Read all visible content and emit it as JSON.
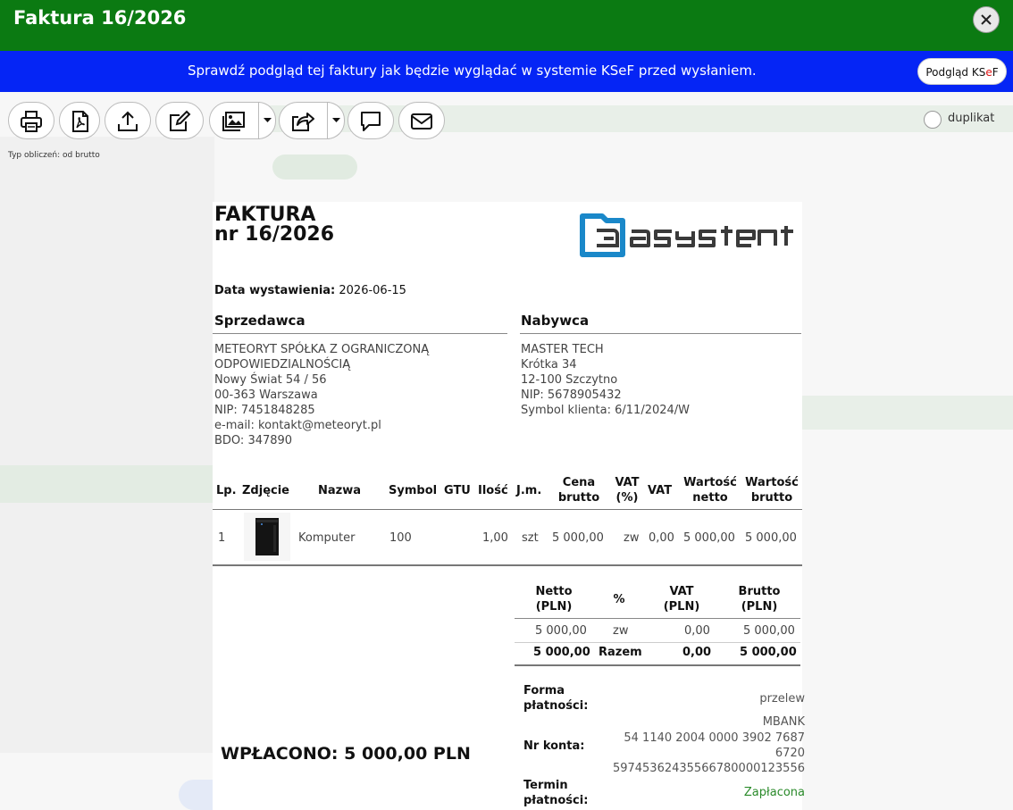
{
  "window": {
    "title": "Faktura 16/2026"
  },
  "ksef": {
    "message": "Sprawdź podgląd tej faktury jak będzie wyglądać w systemie KSeF przed wysłaniem.",
    "button_prefix": "Podgląd KS",
    "button_accent": "e",
    "button_suffix": "F"
  },
  "toolbar": {
    "duplikat_label": "duplikat",
    "calc_type": "Typ obliczeń: od brutto"
  },
  "invoice": {
    "heading_line1": "FAKTURA",
    "heading_line2": "nr 16/2026",
    "date_label": "Data wystawienia:",
    "date_value": "2026-06-15",
    "seller": {
      "title": "Sprzedawca",
      "lines": [
        "METEORYT SPÓŁKA Z OGRANICZONĄ",
        "ODPOWIEDZIALNOŚCIĄ",
        "Nowy Świat 54 / 56",
        "00-363 Warszawa",
        "NIP: 7451848285",
        "e-mail: kontakt@meteoryt.pl",
        "BDO: 347890"
      ]
    },
    "buyer": {
      "title": "Nabywca",
      "lines": [
        "MASTER TECH",
        "Krótka 34",
        "12-100 Szczytno",
        "NIP: 5678905432",
        "Symbol klienta: 6/11/2024/W"
      ]
    },
    "items_header": {
      "lp": "Lp.",
      "photo": "Zdjęcie",
      "name": "Nazwa",
      "symbol": "Symbol",
      "gtu": "GTU",
      "qty": "Ilość",
      "unit": "J.m.",
      "price_l1": "Cena",
      "price_l2": "brutto",
      "vat_l1": "VAT",
      "vat_l2": "(%)",
      "vat": "VAT",
      "net_l1": "Wartość",
      "net_l2": "netto",
      "gross_l1": "Wartość",
      "gross_l2": "brutto"
    },
    "items": [
      {
        "lp": "1",
        "name": "Komputer",
        "symbol": "100",
        "qty": "1,00",
        "unit": "szt",
        "price": "5 000,00",
        "vat_rate": "zw",
        "vat": "0,00",
        "net": "5 000,00",
        "gross": "5 000,00"
      }
    ],
    "summary_header": {
      "net_l1": "Netto",
      "net_l2": "(PLN)",
      "pct": "%",
      "vat_l1": "VAT",
      "vat_l2": "(PLN)",
      "gross_l1": "Brutto",
      "gross_l2": "(PLN)"
    },
    "summary_row": {
      "net": "5 000,00",
      "pct": "zw",
      "vat": "0,00",
      "gross": "5 000,00"
    },
    "summary_total": {
      "net": "5 000,00",
      "label": "Razem",
      "vat": "0,00",
      "gross": "5 000,00"
    },
    "paid_text": "WPŁACONO: 5 000,00 PLN",
    "payment": {
      "form_label_l1": "Forma",
      "form_label_l2": "płatności:",
      "form_value": "przelew",
      "bank": "MBANK",
      "account_label": "Nr konta:",
      "account_l1": "54 1140 2004 0000 3902 7687",
      "account_l2": "6720",
      "account_l3": "59745362435566780000123556",
      "term_label_l1": "Termin",
      "term_label_l2": "płatności:",
      "term_value": "Zapłacona"
    }
  },
  "colors": {
    "title_bar": "#0b7a12",
    "ksef_bar": "#0525f5",
    "logo_blue": "#1a88c9",
    "logo_gray": "#3a3a3a",
    "paid_green": "#2a8a2a"
  },
  "icons": [
    "print-icon",
    "pdf-icon",
    "upload-icon",
    "edit-icon",
    "image-icon",
    "share-icon",
    "comment-icon",
    "mail-icon",
    "close-icon",
    "chevron-down-icon"
  ]
}
